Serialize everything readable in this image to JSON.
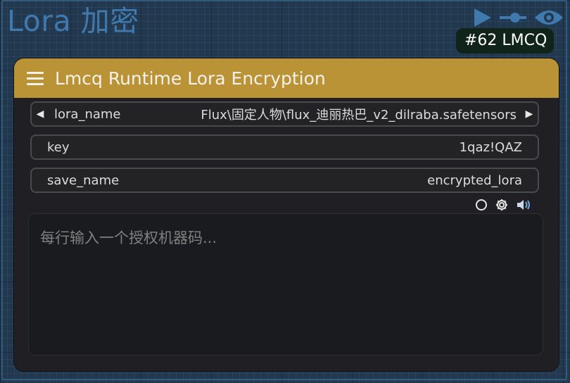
{
  "group": {
    "title": "Lora 加密"
  },
  "badge": {
    "text": "#62 LMCQ"
  },
  "icons": {
    "top": [
      "play-icon",
      "link-icon",
      "eye-icon"
    ],
    "widget_row": [
      "circle-icon",
      "gear-icon",
      "speaker-icon"
    ]
  },
  "node": {
    "title": "Lmcq Runtime Lora Encryption",
    "header_color": "#bb9337",
    "widgets": {
      "lora_name": {
        "label": "lora_name",
        "value": "Flux\\固定人物\\flux_迪丽热巴_v2_dilraba.safetensors"
      },
      "key": {
        "label": "key",
        "value": "1qaz!QAZ"
      },
      "save_name": {
        "label": "save_name",
        "value": "encrypted_lora"
      }
    },
    "textarea": {
      "placeholder": "每行输入一个授权机器码..."
    }
  }
}
